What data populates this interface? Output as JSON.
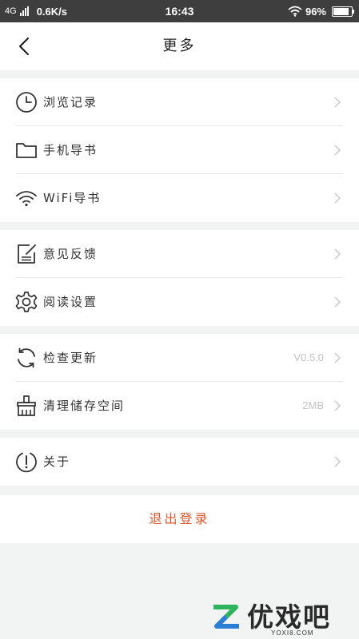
{
  "status_bar": {
    "network": "4G",
    "speed": "0.6K/s",
    "time": "16:43",
    "battery": "96%",
    "battery_level": 0.96
  },
  "header": {
    "title": "更多",
    "back_icon": "chevron-left-icon"
  },
  "groups": [
    {
      "items": [
        {
          "label": "浏览记录",
          "icon": "clock-icon"
        },
        {
          "label": "手机导书",
          "icon": "folder-icon"
        },
        {
          "label": "WiFi导书",
          "icon": "wifi-icon"
        }
      ]
    },
    {
      "items": [
        {
          "label": "意见反馈",
          "icon": "feedback-icon"
        },
        {
          "label": "阅读设置",
          "icon": "gear-icon"
        }
      ]
    },
    {
      "items": [
        {
          "label": "检查更新",
          "value": "V0.5.0",
          "icon": "refresh-icon"
        },
        {
          "label": "清理储存空间",
          "value": "2MB",
          "icon": "broom-icon"
        }
      ]
    },
    {
      "items": [
        {
          "label": "关于",
          "icon": "info-icon"
        }
      ]
    }
  ],
  "logout_label": "退出登录",
  "watermark": {
    "text": "优戏吧",
    "url": "YOXI8.COM"
  },
  "colors": {
    "status_bar": "#3e3e3e",
    "logout": "#e0572d",
    "page_bg": "#f2f3f3",
    "watermark_green": "#2db55d",
    "watermark_blue": "#2a7fd4"
  }
}
